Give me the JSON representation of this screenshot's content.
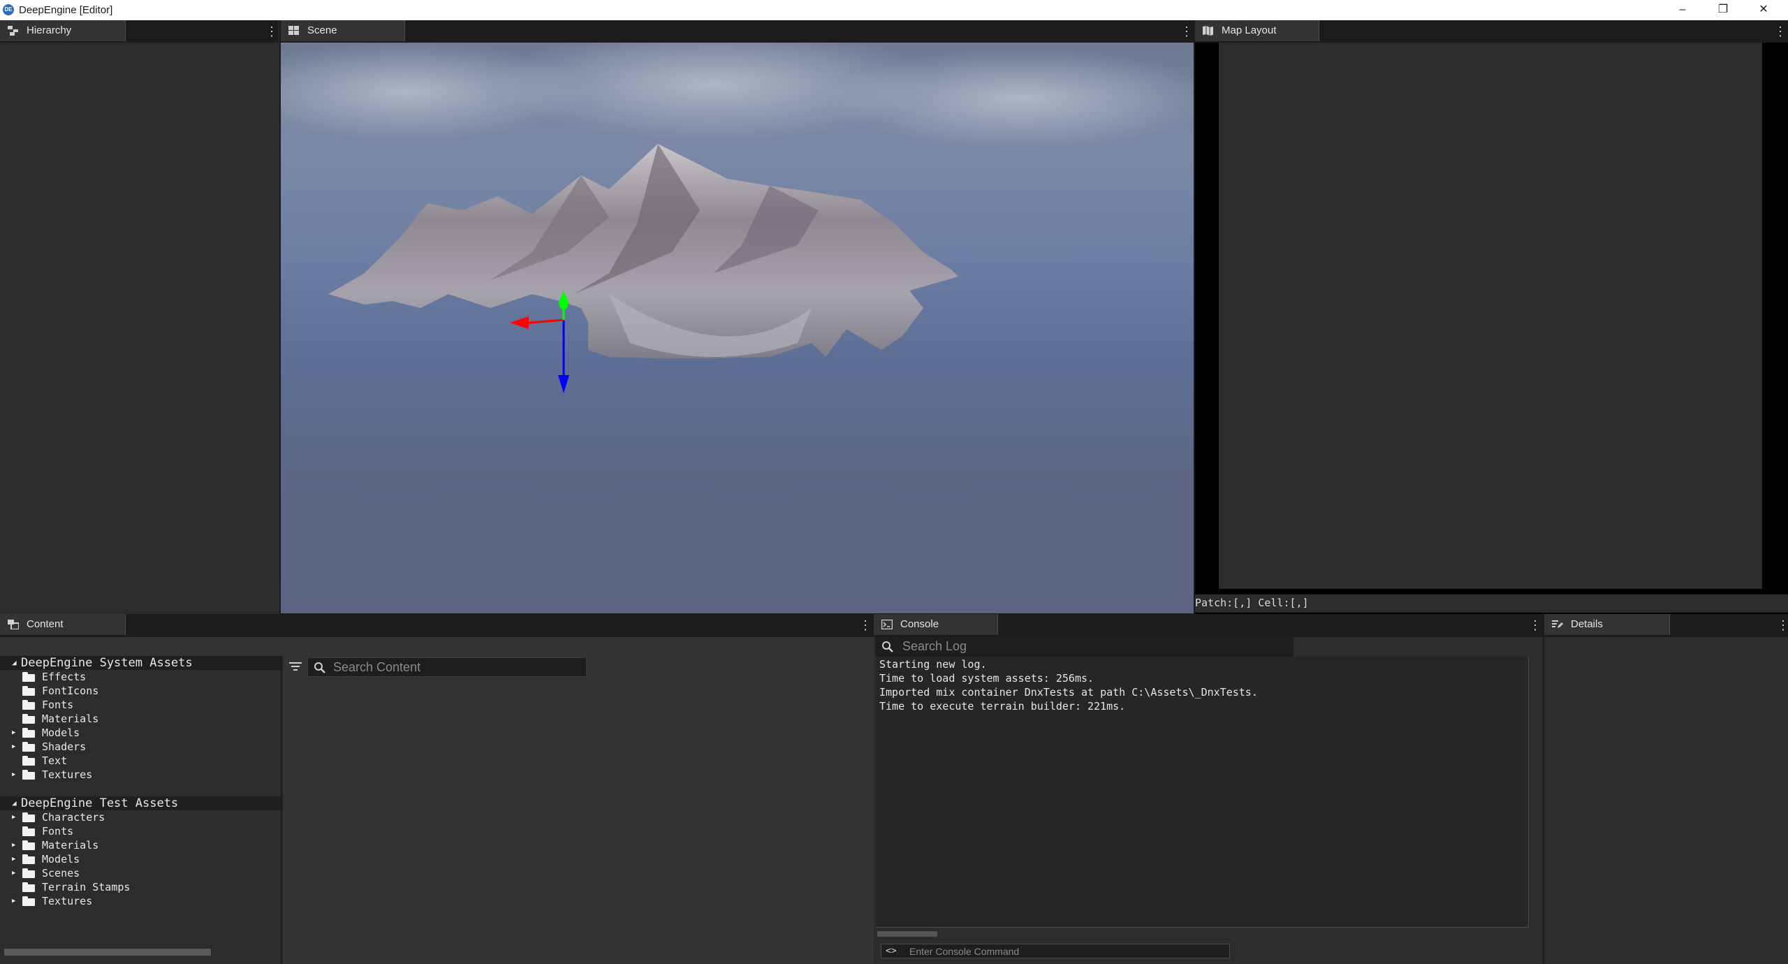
{
  "window": {
    "icon_text": "DE",
    "title": "DeepEngine [Editor]",
    "minimize_glyph": "–",
    "maximize_glyph": "❐",
    "close_glyph": "✕"
  },
  "hierarchy": {
    "tab_label": "Hierarchy",
    "icon": "hierarchy-icon"
  },
  "scene": {
    "tab_label": "Scene",
    "icon": "grid-icon"
  },
  "map_layout": {
    "tab_label": "Map Layout",
    "icon": "map-icon",
    "status": "Patch:[,] Cell:[,]"
  },
  "content": {
    "tab_label": "Content",
    "search_placeholder": "Search Content",
    "groups": [
      {
        "name": "DeepEngine System Assets",
        "items": [
          {
            "label": "Effects",
            "expandable": false
          },
          {
            "label": "FontIcons",
            "expandable": false
          },
          {
            "label": "Fonts",
            "expandable": false
          },
          {
            "label": "Materials",
            "expandable": false
          },
          {
            "label": "Models",
            "expandable": true
          },
          {
            "label": "Shaders",
            "expandable": true
          },
          {
            "label": "Text",
            "expandable": false
          },
          {
            "label": "Textures",
            "expandable": true
          }
        ]
      },
      {
        "name": "DeepEngine Test Assets",
        "items": [
          {
            "label": "Characters",
            "expandable": true
          },
          {
            "label": "Fonts",
            "expandable": false
          },
          {
            "label": "Materials",
            "expandable": true
          },
          {
            "label": "Models",
            "expandable": true
          },
          {
            "label": "Scenes",
            "expandable": true
          },
          {
            "label": "Terrain Stamps",
            "expandable": false
          },
          {
            "label": "Textures",
            "expandable": true
          }
        ]
      }
    ]
  },
  "console": {
    "tab_label": "Console",
    "search_placeholder": "Search Log",
    "lines": [
      "Starting new log.",
      "Time to load system assets: 256ms.",
      "Imported mix container DnxTests at path C:\\Assets\\_DnxTests.",
      "Time to execute terrain builder: 221ms."
    ],
    "command_prefix": "<>",
    "command_placeholder": "Enter Console Command"
  },
  "details": {
    "tab_label": "Details"
  },
  "colors": {
    "gizmo_x": "#ff0000",
    "gizmo_y": "#00ff00",
    "gizmo_z": "#0000ff",
    "accent": "#2c6db5"
  }
}
